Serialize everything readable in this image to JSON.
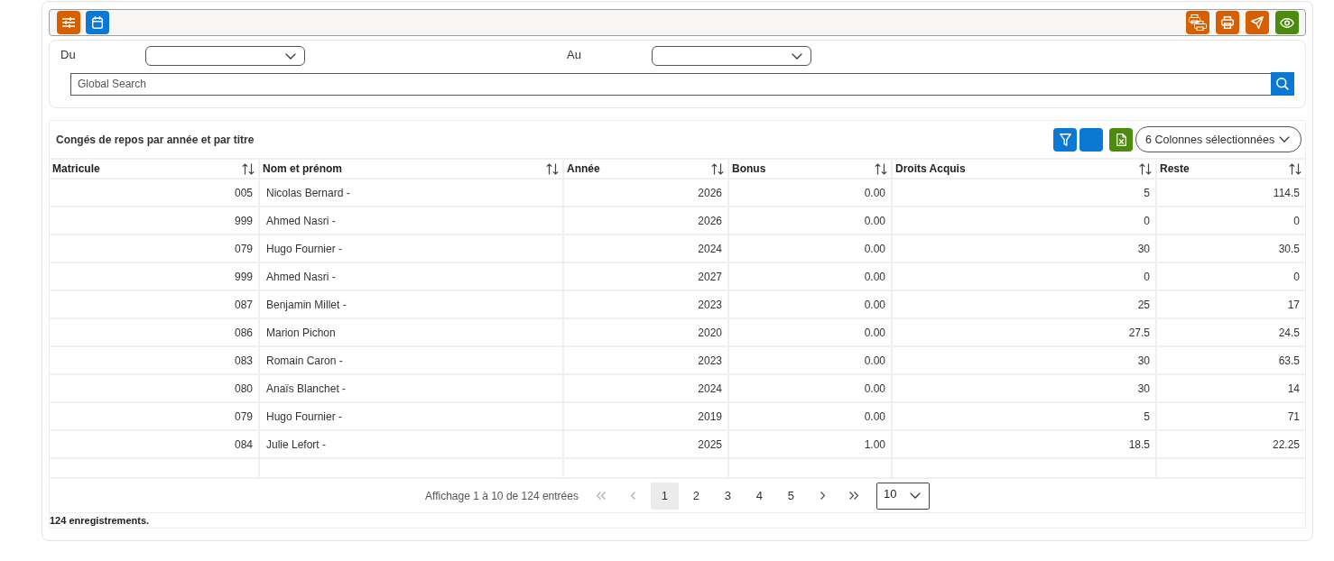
{
  "filters": {
    "date_from": {
      "label": "Du"
    },
    "date_to": {
      "label": "Au"
    },
    "search": {
      "placeholder": "Global Search"
    }
  },
  "table": {
    "title": "Congés de repos par année et par titre",
    "column_selector": {
      "value": "6 Colonnes sélectionnées"
    },
    "columns": [
      {
        "label": "Matricule",
        "kind": "number"
      },
      {
        "label": "Nom et prénom",
        "kind": "text"
      },
      {
        "label": "Année",
        "kind": "number"
      },
      {
        "label": "Bonus",
        "kind": "number"
      },
      {
        "label": "Droits Acquis",
        "kind": "number"
      },
      {
        "label": "Reste",
        "kind": "number"
      }
    ],
    "rows": [
      [
        "005",
        "Nicolas Bernard -",
        "2026",
        "0.00",
        "5",
        "114.5"
      ],
      [
        "999",
        "Ahmed Nasri -",
        "2026",
        "0.00",
        "0",
        "0"
      ],
      [
        "079",
        "Hugo Fournier -",
        "2024",
        "0.00",
        "30",
        "30.5"
      ],
      [
        "999",
        "Ahmed Nasri -",
        "2027",
        "0.00",
        "0",
        "0"
      ],
      [
        "087",
        "Benjamin Millet -",
        "2023",
        "0.00",
        "25",
        "17"
      ],
      [
        "086",
        "Marion Pichon",
        "2020",
        "0.00",
        "27.5",
        "24.5"
      ],
      [
        "083",
        "Romain Caron -",
        "2023",
        "0.00",
        "30",
        "63.5"
      ],
      [
        "080",
        "Anaïs Blanchet -",
        "2024",
        "0.00",
        "30",
        "14"
      ],
      [
        "079",
        "Hugo Fournier -",
        "2019",
        "0.00",
        "5",
        "71"
      ],
      [
        "084",
        "Julie Lefort -",
        "2025",
        "1.00",
        "18.5",
        "22.25"
      ]
    ]
  },
  "pagination": {
    "summary": "Affichage 1 à 10 de 124 entrées",
    "nav_before": [
      {
        "kind": "first",
        "disabled": true
      },
      {
        "kind": "prev",
        "disabled": true
      }
    ],
    "pages": [
      {
        "label": "1",
        "selected": true
      },
      {
        "label": "2",
        "selected": false
      },
      {
        "label": "3",
        "selected": false
      },
      {
        "label": "4",
        "selected": false
      },
      {
        "label": "5",
        "selected": false
      }
    ],
    "nav_after": [
      {
        "kind": "next",
        "disabled": false
      },
      {
        "kind": "last",
        "disabled": false
      }
    ],
    "page_size": {
      "value": "10"
    }
  },
  "footer": {
    "count": "124 enregistrements."
  }
}
